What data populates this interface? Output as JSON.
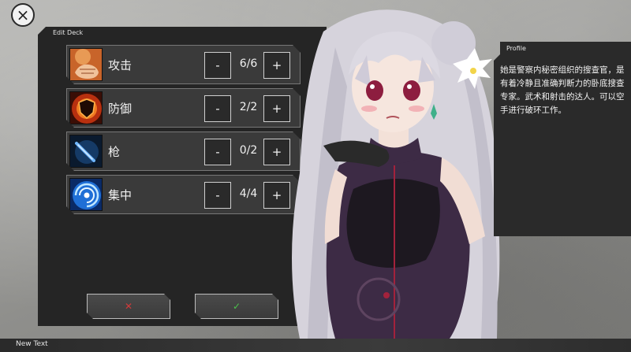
{
  "close_button": {
    "label": "×"
  },
  "deck": {
    "title": "Edit Deck",
    "skills": [
      {
        "name": "攻击",
        "count": "6/6",
        "icon": "fist-icon"
      },
      {
        "name": "防御",
        "count": "2/2",
        "icon": "shield-icon"
      },
      {
        "name": "枪",
        "count": "0/2",
        "icon": "gun-icon"
      },
      {
        "name": "集中",
        "count": "4/4",
        "icon": "vortex-icon"
      }
    ],
    "minus_label": "-",
    "plus_label": "+",
    "cancel_label": "✕",
    "confirm_label": "✓"
  },
  "profile": {
    "title": "Profile",
    "text": "她是警察内秘密组织的搜查官，是有着冷静且准确判断力的卧底搜查专家。武术和射击的达人。可以空手进行破环工作。"
  },
  "bottom_bar": {
    "text": "New Text"
  },
  "colors": {
    "panel_bg": "#252525",
    "cancel": "#d23a3a",
    "confirm": "#4cc24c"
  }
}
